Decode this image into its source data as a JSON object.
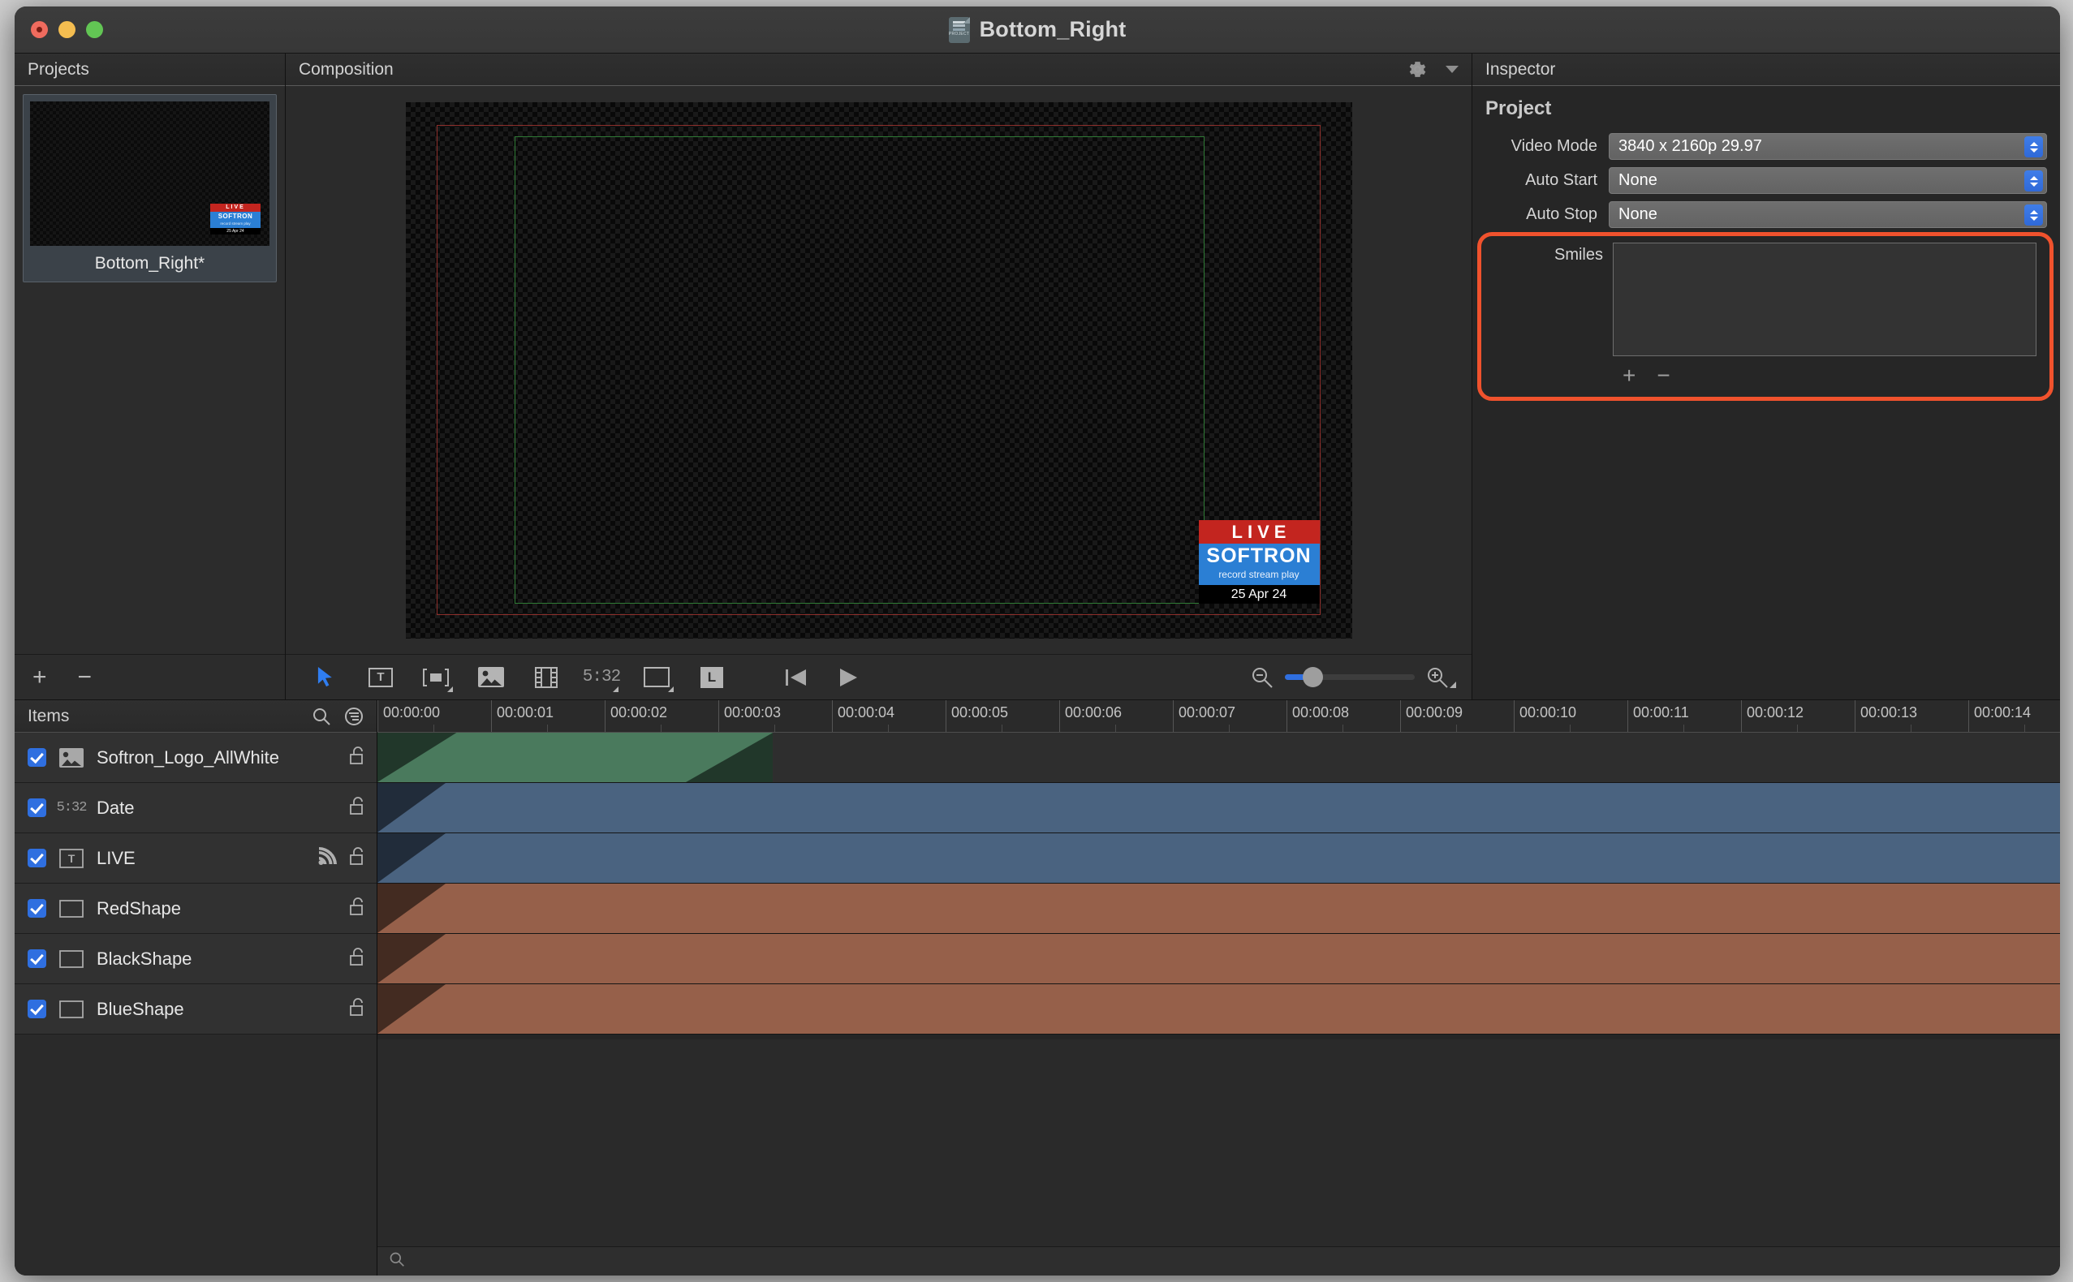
{
  "window": {
    "title": "Bottom_Right",
    "title_icon": "project-document-icon",
    "traffic_lights": [
      "close",
      "minimize",
      "zoom"
    ]
  },
  "projects_panel": {
    "header": "Projects",
    "project": {
      "name": "Bottom_Right*",
      "thumbnail_overlay": {
        "live": "LIVE",
        "brand": "SOFTRON",
        "tagline": "record stream play",
        "date": "25 Apr 24"
      }
    },
    "footer": {
      "add": "+",
      "remove": "−"
    }
  },
  "composition_panel": {
    "header": "Composition",
    "header_icons": [
      "gear-icon",
      "chevron-down-icon"
    ],
    "canvas_overlay": {
      "live": "LIVE",
      "brand": "SOFTRON",
      "tagline": "record stream play",
      "date": "25 Apr 24"
    },
    "guides": {
      "title_safe_color": "#2f7a35",
      "action_safe_color": "#8e2f2b"
    },
    "toolbar": {
      "tools": [
        {
          "name": "pointer-tool",
          "glyph": "arrow",
          "selected": true
        },
        {
          "name": "text-tool",
          "glyph": "T",
          "selected": false
        },
        {
          "name": "scrolling-text-tool",
          "glyph": "scroll",
          "selected": false
        },
        {
          "name": "image-tool",
          "glyph": "image",
          "selected": false
        },
        {
          "name": "video-tool",
          "glyph": "film",
          "selected": false
        },
        {
          "name": "clock-tool",
          "glyph": "5:32",
          "selected": false
        },
        {
          "name": "shape-tool",
          "glyph": "rectangle",
          "selected": false
        },
        {
          "name": "layer-tool",
          "glyph": "L",
          "selected": false
        }
      ],
      "transport": [
        {
          "name": "go-to-start-button",
          "glyph": "skip-back"
        },
        {
          "name": "play-button",
          "glyph": "play"
        }
      ],
      "zoom": {
        "zoom_out": "zoom-out-icon",
        "zoom_in": "zoom-in-icon",
        "slider_value_pct": 18
      }
    }
  },
  "inspector": {
    "header": "Inspector",
    "section_title": "Project",
    "fields": [
      {
        "label": "Video Mode",
        "value": "3840 x 2160p 29.97",
        "control": "popup-button"
      },
      {
        "label": "Auto Start",
        "value": "None",
        "control": "popup-button"
      },
      {
        "label": "Auto Stop",
        "value": "None",
        "control": "popup-button"
      }
    ],
    "smiles": {
      "label": "Smiles",
      "items": [],
      "add": "+",
      "remove": "−",
      "highlight_color": "#f0522d"
    }
  },
  "items_panel": {
    "header": "Items",
    "header_icons": [
      "search-icon",
      "filter-icon"
    ],
    "rows": [
      {
        "name": "Softron_Logo_AllWhite",
        "icon": "image-icon",
        "checked": true,
        "locked": false,
        "has_signal": false
      },
      {
        "name": "Date",
        "icon": "clock-icon",
        "checked": true,
        "locked": false,
        "has_signal": false
      },
      {
        "name": "LIVE",
        "icon": "text-icon",
        "checked": true,
        "locked": false,
        "has_signal": true
      },
      {
        "name": "RedShape",
        "icon": "shape-icon",
        "checked": true,
        "locked": false,
        "has_signal": false
      },
      {
        "name": "BlackShape",
        "icon": "shape-icon",
        "checked": true,
        "locked": false,
        "has_signal": false
      },
      {
        "name": "BlueShape",
        "icon": "shape-icon",
        "checked": true,
        "locked": false,
        "has_signal": false
      }
    ]
  },
  "timeline": {
    "ticks": [
      "00:00:00",
      "00:00:01",
      "00:00:02",
      "00:00:03",
      "00:00:04",
      "00:00:05",
      "00:00:06",
      "00:00:07",
      "00:00:08",
      "00:00:09",
      "00:00:10",
      "00:00:11",
      "00:00:12",
      "00:00:13",
      "00:00:14"
    ],
    "footer_icon": "search-icon",
    "clips": [
      {
        "track": "Softron_Logo_AllWhite",
        "color": "#4a7a5d",
        "start_pct": 0,
        "end_pct": 23.2,
        "fade_in": true,
        "fade_out": true
      },
      {
        "track": "Date",
        "color": "#4a6380",
        "start_pct": 0,
        "end_pct": 100,
        "fade_in": true,
        "fade_out": false
      },
      {
        "track": "LIVE",
        "color": "#4a6380",
        "start_pct": 0,
        "end_pct": 100,
        "fade_in": true,
        "fade_out": false
      },
      {
        "track": "RedShape",
        "color": "#96604a",
        "start_pct": 0,
        "end_pct": 100,
        "fade_in": true,
        "fade_out": false
      },
      {
        "track": "BlackShape",
        "color": "#96604a",
        "start_pct": 0,
        "end_pct": 100,
        "fade_in": true,
        "fade_out": false
      },
      {
        "track": "BlueShape",
        "color": "#96604a",
        "start_pct": 0,
        "end_pct": 100,
        "fade_in": true,
        "fade_out": false
      }
    ]
  }
}
